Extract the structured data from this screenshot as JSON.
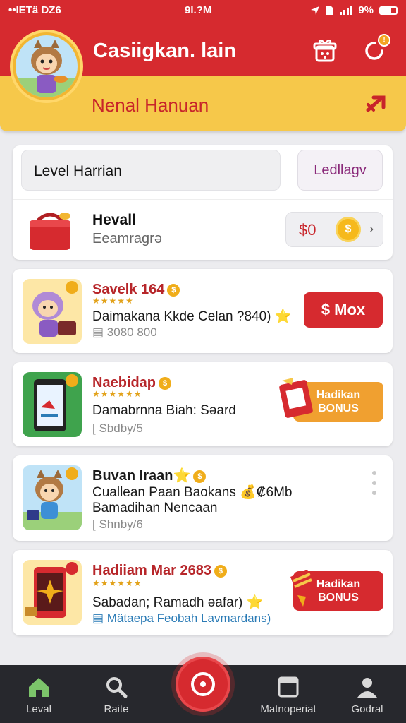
{
  "status_bar": {
    "carrier": "••lETä Ǳ6",
    "time": "9I.?M",
    "battery": "9%"
  },
  "header": {
    "title": "Casiigkan. lain",
    "banner": "Nenal Hanuan",
    "notification_count": "!"
  },
  "level_card": {
    "field_label": "Level Harrian",
    "button_label": "Ledllagv",
    "item_title": "Hevall",
    "item_sub": "Eeamragrə",
    "coin_value": "$0",
    "coin_symbol": "$"
  },
  "items": [
    {
      "title": "Savelk 164",
      "stars": "★★★★★",
      "line1": "Daimakana Kkde Celan ?840) ⭐",
      "sub": "▤ 3080 800",
      "action": "$ Mox"
    },
    {
      "title": "Naebidap",
      "stars": "★★★★★★",
      "line1": "Damabrnna Biah: Səard",
      "sub": "[ Sbdby/5",
      "action_line1": "Hadikan",
      "action_line2": "BONUS"
    },
    {
      "title": "Buvan lraan⭐",
      "line1": "Cuallean Paan Baokans 💰₡6Mb",
      "line2": "Bamadihan Nencaan",
      "sub": "[ Shnby/6"
    },
    {
      "title": "Hadiiam Mar 2683",
      "stars": "★★★★★★",
      "line1": "Sabadan; Ramadh əafar) ⭐",
      "sub": "▤ Mätaepa Feobah Lavmardans)",
      "action_line1": "Hadikan",
      "action_line2": "BONUS"
    }
  ],
  "bottom_nav": [
    {
      "label": "Leval",
      "icon": "home-icon"
    },
    {
      "label": "Raite",
      "icon": "search-icon"
    },
    {
      "label": "Matnoperiat",
      "icon": "calendar-icon"
    },
    {
      "label": "Godral",
      "icon": "profile-icon"
    }
  ],
  "colors": {
    "primary": "#d62a2f",
    "banner": "#f6c84a",
    "nav": "#27282d",
    "gold": "#f0ad1a"
  }
}
